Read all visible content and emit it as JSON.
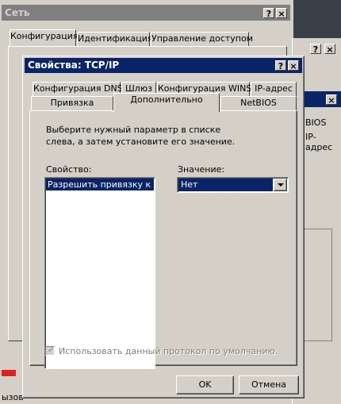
{
  "bg_window": {
    "title": "Сеть",
    "tabs": [
      "Конфигурация",
      "Идентификация",
      "Управление доступом"
    ],
    "side_texts": [
      "BIOS",
      "IP-адрес"
    ],
    "bottom_left_text": "ызов"
  },
  "dialog": {
    "title": "Свойства: TCP/IP",
    "help_btn": "?",
    "close_btn": "×",
    "tabs_row1": [
      "Конфигурация DNS",
      "Шлюз",
      "Конфигурация WINS",
      "IP-адрес"
    ],
    "tabs_row2": [
      "Привязка",
      "Дополнительно",
      "NetBIOS"
    ],
    "description": "Выберите нужный параметр в списке слева, а затем установите его значение.",
    "property_label": "Свойство:",
    "value_label": "Значение:",
    "property_items": [
      "Разрешить привязку к ATM"
    ],
    "selected_value": "Нет",
    "default_checkbox_label": "Использовать данный протокол по умолчанию.",
    "ok_label": "OK",
    "cancel_label": "Отмена"
  },
  "colors": {
    "active_title": "#0a246a",
    "inactive_title": "#808080",
    "face": "#d4d0c8",
    "selection": "#0a246a"
  }
}
